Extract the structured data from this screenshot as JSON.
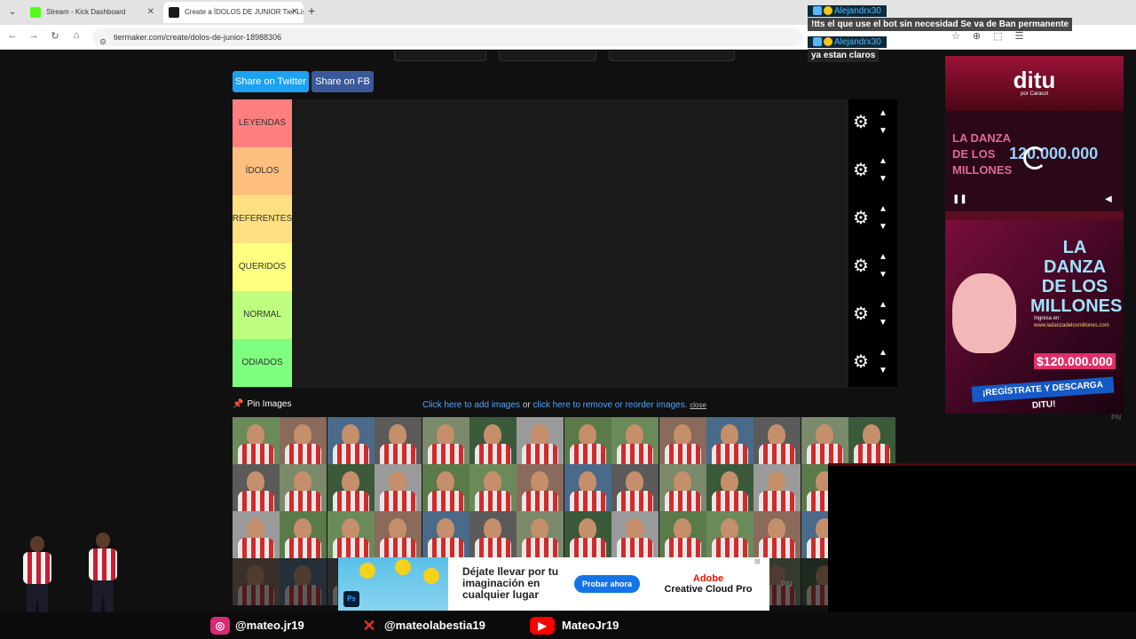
{
  "browser": {
    "tabs": [
      {
        "label": "Stream - Kick Dashboard",
        "fav_color": "#53fc18"
      },
      {
        "label": "Create a ÍDOLOS DE JUNIOR Tier List",
        "fav_color": "#1a1a1a"
      }
    ],
    "url": "tiermaker.com/create/dolos-de-junior-18988306"
  },
  "share": {
    "twitter": "Share on Twitter",
    "fb": "Share on FB"
  },
  "tiers": [
    {
      "label": "LEYENDAS",
      "color": "#ff7f7f"
    },
    {
      "label": "ÍDOLOS",
      "color": "#ffbf7f"
    },
    {
      "label": "REFERENTES",
      "color": "#ffdf7f"
    },
    {
      "label": "QUERIDOS",
      "color": "#ffff7f"
    },
    {
      "label": "NORMAL",
      "color": "#bfff7f"
    },
    {
      "label": "ODIADOS",
      "color": "#7fff7f"
    }
  ],
  "pin": {
    "label": "Pin Images"
  },
  "image_links": {
    "add": "Click here to add images",
    "or": "or",
    "remove": "click here to remove or reorder images.",
    "close": "close"
  },
  "chat": [
    {
      "user": "Alejandrx30",
      "message": "!tts el que use el bot sin necesidad Se va de Ban permanente"
    },
    {
      "user": "Alejandrx30",
      "message": "ya estan claros"
    }
  ],
  "ad_side": {
    "logo": "ditu",
    "logo_sub": "por Caracol",
    "video_title": "LA DANZA DE LOS MILLONES",
    "video_amount": "120.000.000",
    "headline": "LA DANZA DE LOS MILLONES",
    "ingresa": "Ingresa en:",
    "site": "www.ladanzadelosmillones.com",
    "prize": "$120.000.000",
    "cta": "¡REGÍSTRATE Y DESCARGA DITU!"
  },
  "ad_bottom": {
    "text": "Déjate llevar por tu imaginación en cualquier lugar",
    "cta": "Probar ahora",
    "brand_top": "Adobe",
    "brand": "Creative Cloud Pro",
    "ps": "Ps"
  },
  "pn_marks": [
    "PN",
    "PN"
  ],
  "social": [
    {
      "handle": "@mateo.jr19",
      "icon": "instagram-icon"
    },
    {
      "handle": "@mateolabestia19",
      "icon": "x-icon"
    },
    {
      "handle": "MateoJr19",
      "icon": "youtube-icon"
    }
  ]
}
